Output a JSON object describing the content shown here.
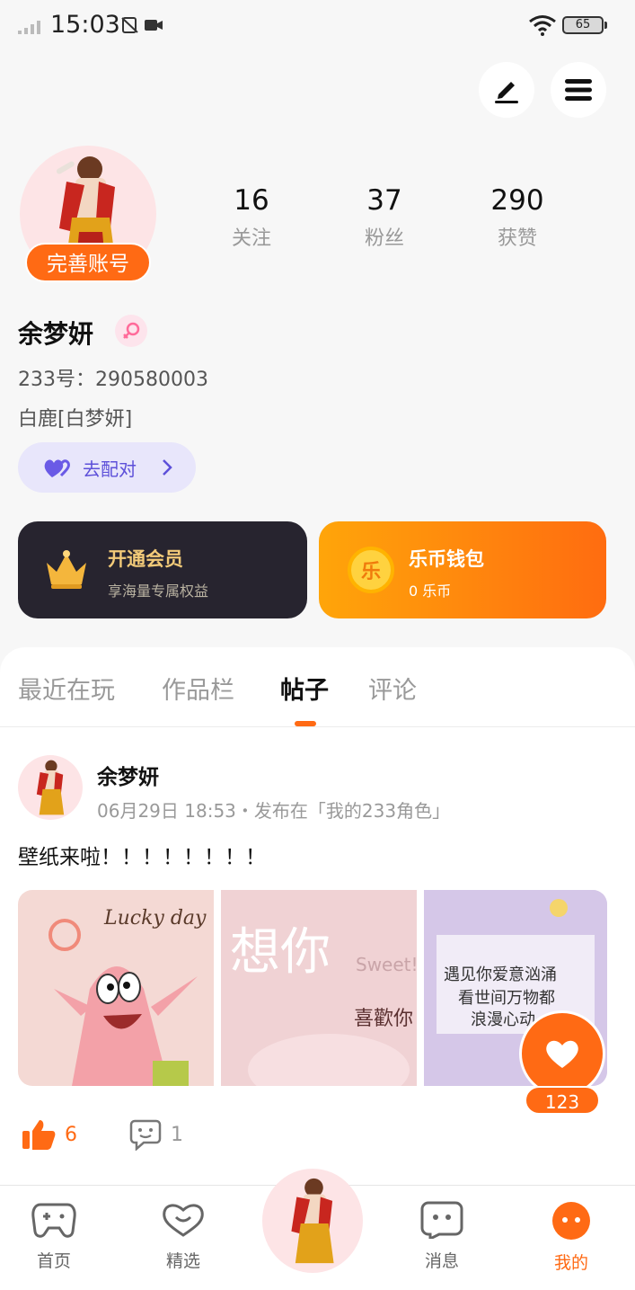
{
  "status_bar": {
    "time": "15:03",
    "battery": "65"
  },
  "profile": {
    "complete_account_label": "完善账号",
    "stats": [
      {
        "value": "16",
        "label": "关注"
      },
      {
        "value": "37",
        "label": "粉丝"
      },
      {
        "value": "290",
        "label": "获赞"
      }
    ],
    "name": "余梦妍",
    "uid": "233号：290580003",
    "nickname": "白鹿[白梦妍]",
    "pair_label": "去配对"
  },
  "cards": {
    "vip": {
      "title": "开通会员",
      "subtitle": "享海量专属权益"
    },
    "wallet": {
      "title": "乐币钱包",
      "subtitle": "0 乐币",
      "coin_glyph": "乐"
    }
  },
  "tabs": [
    "最近在玩",
    "作品栏",
    "帖子",
    "评论"
  ],
  "active_tab": "帖子",
  "post": {
    "author": "余梦妍",
    "meta": "06月29日 18:53・发布在「我的233角色」",
    "text": "壁纸来啦！！！！！！！！",
    "images": [
      {
        "caption": "Lucky day"
      },
      {
        "caption": "想你",
        "sub": "喜歡你",
        "extra": "Sweet!"
      },
      {
        "caption": "遇见你爱意汹涌",
        "line2": "看世间万物都",
        "line3": "浪漫心动"
      }
    ],
    "likes": "6",
    "comments": "1",
    "fab_count": "123"
  },
  "bottom_nav": [
    {
      "label": "首页",
      "icon": "gamepad-icon"
    },
    {
      "label": "精选",
      "icon": "heart-chat-icon"
    },
    {
      "label": "消息",
      "icon": "message-icon"
    },
    {
      "label": "我的",
      "icon": "me-icon"
    }
  ],
  "colors": {
    "accent": "#ff6a14",
    "pair": "#5d50d9",
    "vip_bg": "#27242f",
    "vip_gold": "#f3cb79"
  }
}
